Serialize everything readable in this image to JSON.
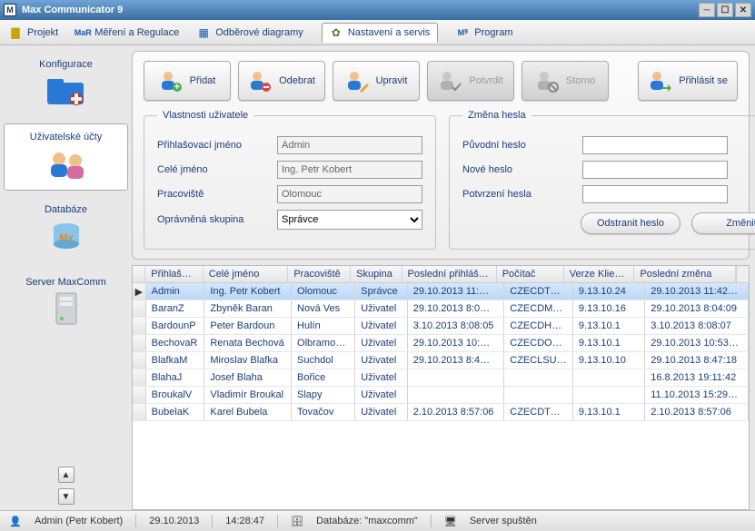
{
  "window": {
    "title": "Max Communicator 9"
  },
  "menu": {
    "projekt": "Projekt",
    "mereni": "Měření a Regulace",
    "diagramy": "Odběrové diagramy",
    "nastaveni": "Nastavení a servis",
    "program": "Program"
  },
  "leftnav": {
    "konfigurace": "Konfigurace",
    "ucty": "Uživatelské účty",
    "databaze": "Databáze",
    "server": "Server MaxComm"
  },
  "toolbar": {
    "pridat": "Přidat",
    "odebrat": "Odebrat",
    "upravit": "Upravit",
    "potvrdit": "Potvrdit",
    "storno": "Storno",
    "prihlasit": "Přihlásit se"
  },
  "props": {
    "legend": "Vlastnosti uživatele",
    "login_label": "Přihlašovací jméno",
    "login_value": "Admin",
    "fullname_label": "Celé jméno",
    "fullname_value": "Ing. Petr Kobert",
    "workplace_label": "Pracoviště",
    "workplace_value": "Olomouc",
    "group_label": "Oprávněná skupina",
    "group_value": "Správce"
  },
  "passchange": {
    "legend": "Změna hesla",
    "orig_label": "Původní heslo",
    "new_label": "Nové heslo",
    "confirm_label": "Potvrzení hesla",
    "remove_btn": "Odstranit heslo",
    "change_btn": "Změnit"
  },
  "grid": {
    "headers": {
      "login": "Přihlašov…",
      "fullname": "Celé jméno",
      "workplace": "Pracoviště",
      "group": "Skupina",
      "lastlogin": "Poslední přihlášení",
      "computer": "Počítač",
      "clientver": "Verze Klienta",
      "lastchange": "Poslední změna"
    },
    "rows": [
      {
        "login": "Admin",
        "fullname": "Ing. Petr Kobert",
        "workplace": "Olomouc",
        "group": "Správce",
        "lastlogin": "29.10.2013 11:…",
        "computer": "CZECDTO…",
        "clientver": "9.13.10.24",
        "lastchange": "29.10.2013 11:42…",
        "selected": true
      },
      {
        "login": "BaranZ",
        "fullname": "Zbyněk Baran",
        "workplace": "Nová Ves",
        "group": "Uživatel",
        "lastlogin": "29.10.2013 8:0…",
        "computer": "CZECDMO…",
        "clientver": "9.13.10.16",
        "lastchange": "29.10.2013 8:04:09"
      },
      {
        "login": "BardounP",
        "fullname": "Peter Bardoun",
        "workplace": "Hulín",
        "group": "Uživatel",
        "lastlogin": "3.10.2013 8:08:05",
        "computer": "CZECDHU…",
        "clientver": "9.13.10.1",
        "lastchange": "3.10.2013 8:08:07"
      },
      {
        "login": "BechovaR",
        "fullname": "Renata Bechová",
        "workplace": "Olbramov…",
        "group": "Uživatel",
        "lastlogin": "29.10.2013 10:…",
        "computer": "CZECDOL…",
        "clientver": "9.13.10.1",
        "lastchange": "29.10.2013 10:53…"
      },
      {
        "login": "BlafkaM",
        "fullname": "Miroslav Blafka",
        "workplace": "Suchdol",
        "group": "Uživatel",
        "lastlogin": "29.10.2013 8:4…",
        "computer": "CZECLSU…",
        "clientver": "9.13.10.10",
        "lastchange": "29.10.2013 8:47:18"
      },
      {
        "login": "BlahaJ",
        "fullname": "Josef Blaha",
        "workplace": "Bořice",
        "group": "Uživatel",
        "lastlogin": "",
        "computer": "",
        "clientver": "",
        "lastchange": "16.8.2013 19:11:42"
      },
      {
        "login": "BroukalV",
        "fullname": "Vladimír Broukal",
        "workplace": "Slapy",
        "group": "Uživatel",
        "lastlogin": "",
        "computer": "",
        "clientver": "",
        "lastchange": "11.10.2013 15:29…"
      },
      {
        "login": "BubelaK",
        "fullname": "Karel Bubela",
        "workplace": "Tovačov",
        "group": "Uživatel",
        "lastlogin": "2.10.2013 8:57:06",
        "computer": "CZECDTO…",
        "clientver": "9.13.10.1",
        "lastchange": "2.10.2013 8:57:06"
      }
    ]
  },
  "statusbar": {
    "user": "Admin (Petr Kobert)",
    "date": "29.10.2013",
    "time": "14:28:47",
    "db": "Databáze: \"maxcomm\"",
    "server": "Server spuštěn"
  }
}
